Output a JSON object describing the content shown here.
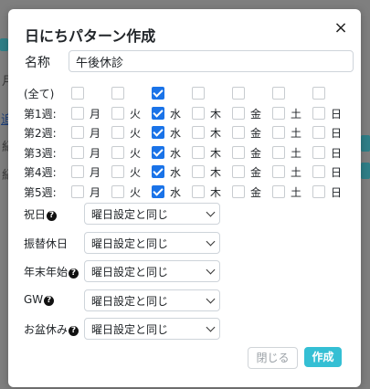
{
  "dialog": {
    "title": "日にちパターン作成",
    "close_glyph": "×",
    "name_label": "名称",
    "name_value": "午後休診"
  },
  "day_headers": [
    "月",
    "火",
    "水",
    "木",
    "金",
    "土",
    "日"
  ],
  "week_rows": [
    {
      "label": "(全て)",
      "show_days": false,
      "checked": [
        false,
        false,
        true,
        false,
        false,
        false,
        false
      ]
    },
    {
      "label": "第1週:",
      "show_days": true,
      "checked": [
        false,
        false,
        true,
        false,
        false,
        false,
        false
      ]
    },
    {
      "label": "第2週:",
      "show_days": true,
      "checked": [
        false,
        false,
        true,
        false,
        false,
        false,
        false
      ]
    },
    {
      "label": "第3週:",
      "show_days": true,
      "checked": [
        false,
        false,
        true,
        false,
        false,
        false,
        false
      ]
    },
    {
      "label": "第4週:",
      "show_days": true,
      "checked": [
        false,
        false,
        true,
        false,
        false,
        false,
        false
      ]
    },
    {
      "label": "第5週:",
      "show_days": true,
      "checked": [
        false,
        false,
        true,
        false,
        false,
        false,
        false
      ]
    }
  ],
  "holiday_settings": [
    {
      "label": "祝日",
      "help": true,
      "value": "曜日設定と同じ"
    },
    {
      "label": "振替休日",
      "help": false,
      "value": "曜日設定と同じ"
    },
    {
      "label": "年末年始",
      "help": true,
      "value": "曜日設定と同じ"
    },
    {
      "label": "GW",
      "help": true,
      "value": "曜日設定と同じ"
    },
    {
      "label": "お盆休み",
      "help": true,
      "value": "曜日設定と同じ"
    }
  ],
  "help_glyph": "?",
  "buttons": {
    "close_label": "閉じる",
    "create_label": "作成"
  },
  "colors": {
    "accent": "#34bfd4",
    "checkbox_checked": "#1a73e8",
    "backdrop": "#7f7f7f"
  }
}
